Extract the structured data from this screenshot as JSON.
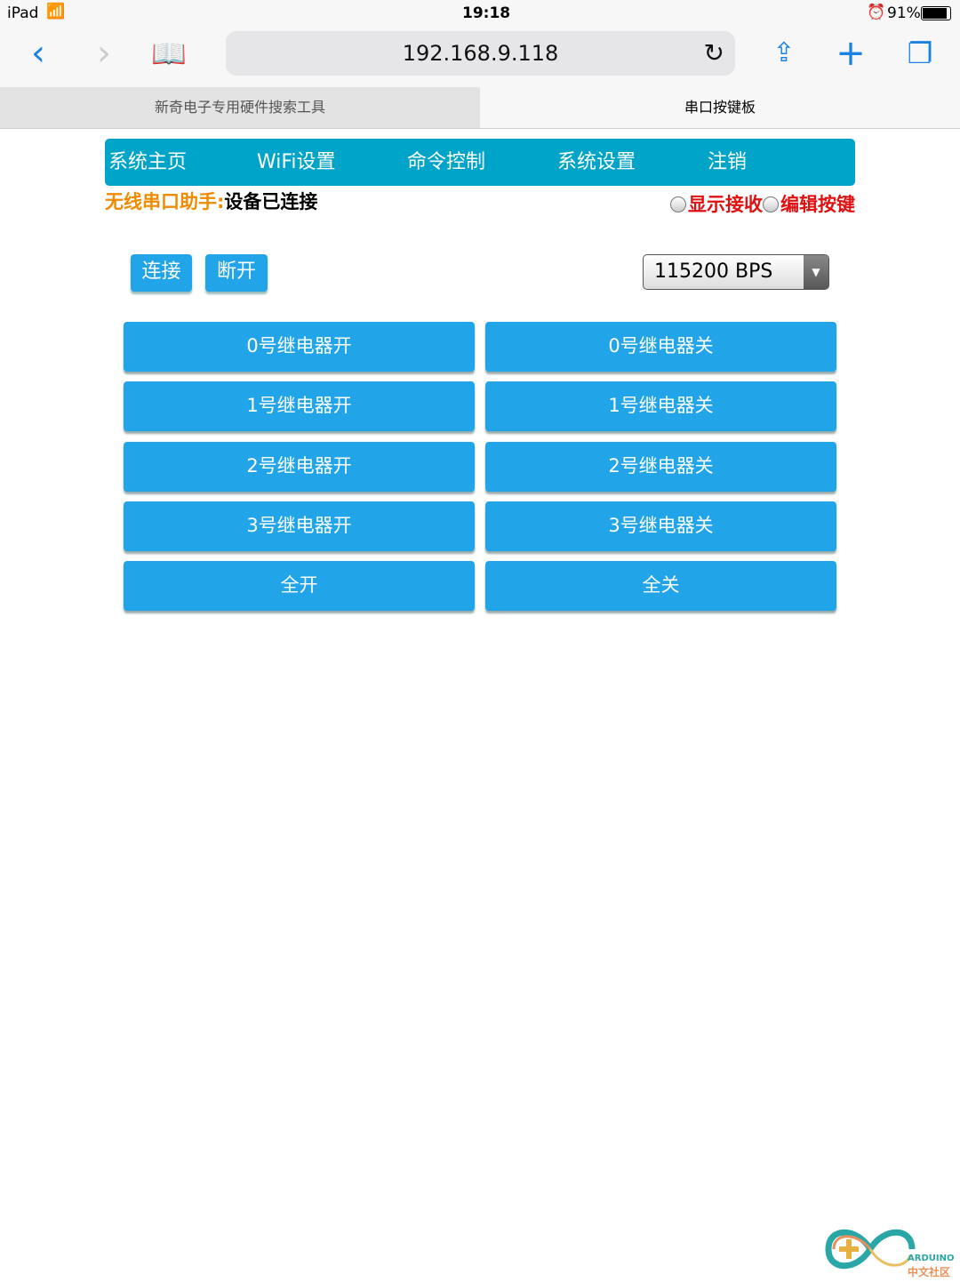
{
  "status": {
    "device": "iPad",
    "time": "19:18",
    "battery": "91%"
  },
  "browser": {
    "url": "192.168.9.118",
    "tabs": [
      {
        "label": "新奇电子专用硬件搜索工具",
        "active": false
      },
      {
        "label": "串口按键板",
        "active": true
      }
    ]
  },
  "nav": [
    "系统主页",
    "WiFi设置",
    "命令控制",
    "系统设置",
    "注销"
  ],
  "state": {
    "label": "无线串口助手:",
    "value": "设备已连接"
  },
  "options": [
    "显示接收",
    "编辑按键"
  ],
  "controls": {
    "connect": "连接",
    "disconnect": "断开",
    "baud": "115200 BPS"
  },
  "relays": [
    [
      "0号继电器开",
      "0号继电器关"
    ],
    [
      "1号继电器开",
      "1号继电器关"
    ],
    [
      "2号继电器开",
      "2号继电器关"
    ],
    [
      "3号继电器开",
      "3号继电器关"
    ],
    [
      "全开",
      "全关"
    ]
  ],
  "logo": {
    "text": "ARDUINO",
    "subtext": "中文社区"
  },
  "colors": {
    "nav": "#00a4c8",
    "button": "#22a4e8",
    "label": "#f08a00",
    "option": "#e01010"
  }
}
